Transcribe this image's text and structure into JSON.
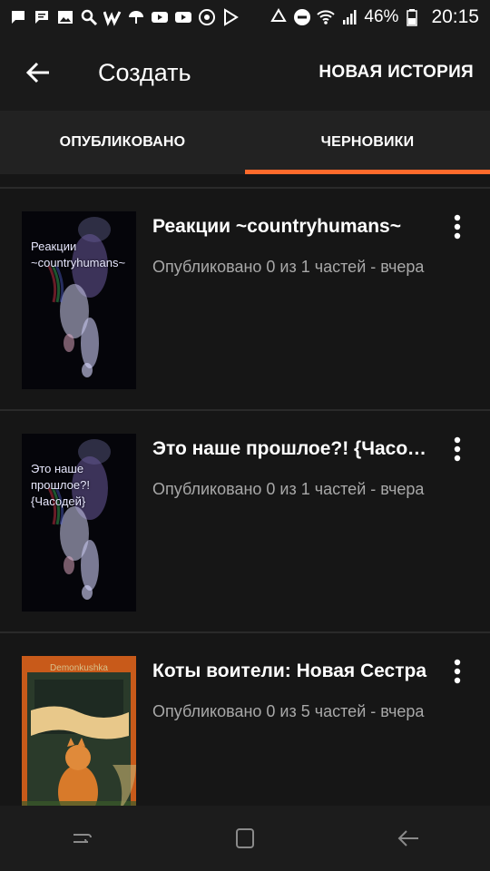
{
  "status_bar": {
    "battery": "46%",
    "time": "20:15"
  },
  "app_bar": {
    "title": "Создать",
    "new_story": "НОВАЯ ИСТОРИЯ"
  },
  "tabs": [
    {
      "label": "ОПУБЛИКОВАНО",
      "active": false
    },
    {
      "label": "ЧЕРНОВИКИ",
      "active": true
    }
  ],
  "stories": [
    {
      "title": "Реакции ~countryhumans~",
      "meta": "Опубликовано 0 из 1 частей - вчера",
      "cover_text": "Реакции ~countryhumans~"
    },
    {
      "title": "Это наше прошлое?! {Часодей}",
      "meta": "Опубликовано 0 из 1 частей - вчера",
      "cover_text": "Это наше прошлое?! {Часодей}"
    },
    {
      "title": "Коты воители: Новая Сестра",
      "meta": "Опубликовано 0 из 5 частей - вчера",
      "cover_text": "Demonkushka"
    }
  ],
  "colors": {
    "accent": "#ff6a2b",
    "background": "#161616",
    "meta_text": "#a8a8a8"
  }
}
